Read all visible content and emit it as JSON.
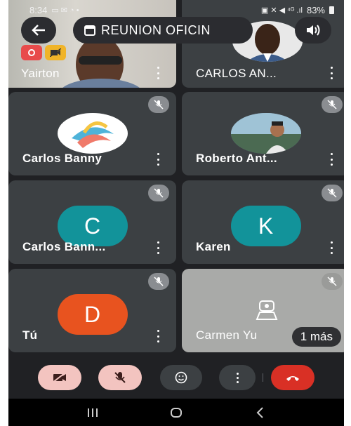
{
  "status_bar": {
    "time": "8:34",
    "battery": "83%"
  },
  "header": {
    "title": "REUNION OFICIN"
  },
  "tiles": [
    {
      "name": "Yairton"
    },
    {
      "name": "CARLOS AN..."
    },
    {
      "name": "Carlos Banny"
    },
    {
      "name": "Roberto Ant..."
    },
    {
      "name": "Carlos Bann...",
      "initial": "C",
      "color": "#12939a"
    },
    {
      "name": "Karen",
      "initial": "K",
      "color": "#12939a"
    },
    {
      "name": "Tú",
      "initial": "D",
      "color": "#e8531f"
    },
    {
      "name": "Carmen Yu",
      "more_label": "1 más"
    }
  ],
  "colors": {
    "background": "#202124",
    "tile": "#3c4043",
    "end_call": "#d93025",
    "toggle_off": "#f3c4c0"
  },
  "icons": [
    "back-arrow-icon",
    "calendar-icon",
    "speaker-icon",
    "mic-off-icon",
    "video-off-icon",
    "emoji-icon",
    "more-vert-icon",
    "hang-up-icon",
    "webcam-icon"
  ]
}
